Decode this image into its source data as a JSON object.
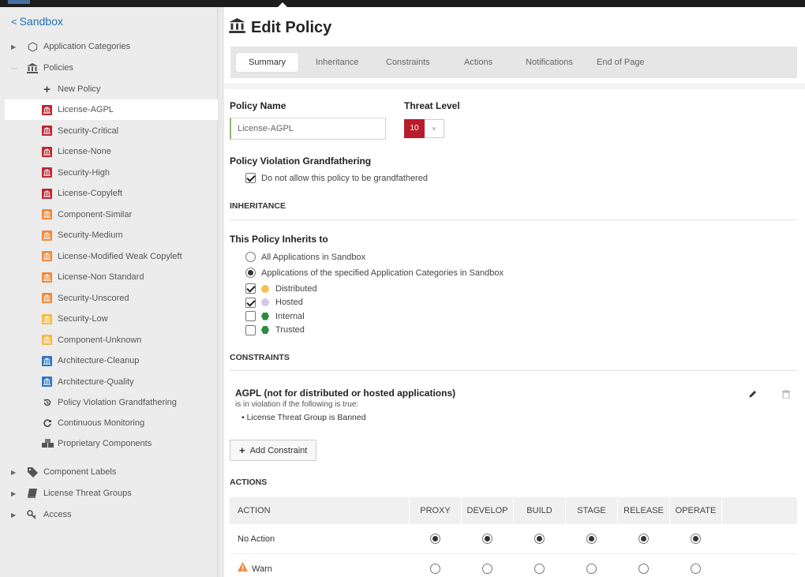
{
  "sidebar": {
    "back_label": "Sandbox",
    "top_items": [
      {
        "label": "Application Categories",
        "icon": "hexagon-outline-icon"
      },
      {
        "label": "Policies",
        "icon": "bank-icon"
      }
    ],
    "new_policy_label": "New Policy",
    "policies": [
      {
        "label": "License-AGPL",
        "color": "#c0282d",
        "selected": true
      },
      {
        "label": "Security-Critical",
        "color": "#c0282d"
      },
      {
        "label": "License-None",
        "color": "#c0282d"
      },
      {
        "label": "Security-High",
        "color": "#c0282d"
      },
      {
        "label": "License-Copyleft",
        "color": "#c0282d"
      },
      {
        "label": "Component-Similar",
        "color": "#f08a3c"
      },
      {
        "label": "Security-Medium",
        "color": "#f08a3c"
      },
      {
        "label": "License-Modified Weak Copyleft",
        "color": "#f08a3c"
      },
      {
        "label": "License-Non Standard",
        "color": "#f08a3c"
      },
      {
        "label": "Security-Unscored",
        "color": "#f08a3c"
      },
      {
        "label": "Security-Low",
        "color": "#f5b942"
      },
      {
        "label": "Component-Unknown",
        "color": "#f5b942"
      },
      {
        "label": "Architecture-Cleanup",
        "color": "#2f78c4"
      },
      {
        "label": "Architecture-Quality",
        "color": "#2f78c4"
      }
    ],
    "extras": [
      {
        "label": "Policy Violation Grandfathering",
        "icon": "history-icon"
      },
      {
        "label": "Continuous Monitoring",
        "icon": "refresh-icon"
      },
      {
        "label": "Proprietary Components",
        "icon": "cubes-icon"
      }
    ],
    "bottom_items": [
      {
        "label": "Component Labels",
        "icon": "tag-icon"
      },
      {
        "label": "License Threat Groups",
        "icon": "book-icon"
      },
      {
        "label": "Access",
        "icon": "key-icon"
      }
    ]
  },
  "header": {
    "title": "Edit Policy",
    "tabs": [
      "Summary",
      "Inheritance",
      "Constraints",
      "Actions",
      "Notifications",
      "End of Page"
    ]
  },
  "form": {
    "policy_name_label": "Policy Name",
    "policy_name_value": "License-AGPL",
    "threat_level_label": "Threat Level",
    "threat_level_value": "10",
    "threat_color": "#b81c2c",
    "grandfathering_label": "Policy Violation Grandfathering",
    "grandfathering_checkbox": "Do not allow this policy to be grandfathered"
  },
  "inheritance": {
    "section": "INHERITANCE",
    "inherits_label": "This Policy Inherits to",
    "option_all": "All Applications in Sandbox",
    "option_specified": "Applications of the specified Application Categories in Sandbox",
    "categories": [
      {
        "label": "Distributed",
        "checked": true,
        "color": "#f2c14e",
        "shape": "dot"
      },
      {
        "label": "Hosted",
        "checked": true,
        "color": "#d9c6e8",
        "shape": "dot"
      },
      {
        "label": "Internal",
        "checked": false,
        "color": "#2e8b3a",
        "shape": "hex"
      },
      {
        "label": "Trusted",
        "checked": false,
        "color": "#2e8b3a",
        "shape": "hex"
      }
    ]
  },
  "constraints": {
    "section": "CONSTRAINTS",
    "name": "AGPL (not for distributed or hosted applications)",
    "subtitle": "is in violation if the following is true:",
    "condition": "• License Threat Group is Banned",
    "add_label": "Add Constraint"
  },
  "actions": {
    "section": "ACTIONS",
    "columns": [
      "ACTION",
      "PROXY",
      "DEVELOP",
      "BUILD",
      "STAGE",
      "RELEASE",
      "OPERATE"
    ],
    "rows": [
      {
        "label": "No Action",
        "selected": [
          true,
          true,
          true,
          true,
          true,
          true
        ]
      },
      {
        "label": "Warn",
        "selected": [
          false,
          false,
          false,
          false,
          false,
          false
        ]
      }
    ]
  }
}
